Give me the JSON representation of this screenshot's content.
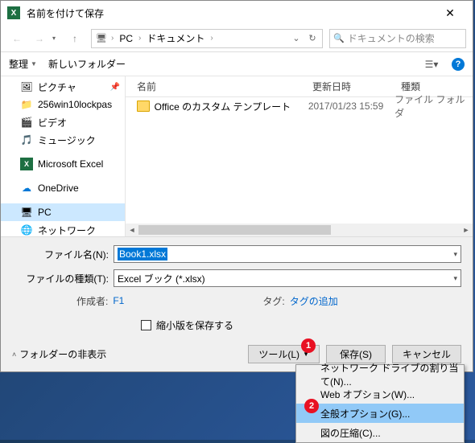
{
  "title": "名前を付けて保存",
  "nav": {
    "pc": "PC",
    "folder": "ドキュメント",
    "search_placeholder": "ドキュメントの検索",
    "refresh": "↻"
  },
  "toolbar": {
    "organize": "整理",
    "newfolder": "新しいフォルダー"
  },
  "sidebar": [
    {
      "icon": "🖼",
      "label": "ピクチャ",
      "pinned": true
    },
    {
      "icon": "📁",
      "label": "256win10lockpas"
    },
    {
      "icon": "🎬",
      "label": "ビデオ"
    },
    {
      "icon": "🎵",
      "label": "ミュージック"
    },
    {
      "icon": "X",
      "label": "Microsoft Excel",
      "excel": true
    },
    {
      "icon": "☁",
      "label": "OneDrive",
      "blue": true
    },
    {
      "icon": "🖥",
      "label": "PC",
      "selected": true
    },
    {
      "icon": "🌐",
      "label": "ネットワーク"
    }
  ],
  "filelist": {
    "headers": {
      "name": "名前",
      "date": "更新日時",
      "type": "種類"
    },
    "rows": [
      {
        "name": "Office のカスタム テンプレート",
        "date": "2017/01/23 15:59",
        "type": "ファイル フォルダ"
      }
    ]
  },
  "fields": {
    "filename_label": "ファイル名(N):",
    "filename_value": "Book1.xlsx",
    "filetype_label": "ファイルの種類(T):",
    "filetype_value": "Excel ブック (*.xlsx)",
    "author_label": "作成者:",
    "author_value": "F1",
    "tag_label": "タグ:",
    "tag_value": "タグの追加",
    "thumbnail_label": "縮小版を保存する"
  },
  "buttons": {
    "expand": "フォルダーの非表示",
    "tools": "ツール(L)",
    "save": "保存(S)",
    "cancel": "キャンセル"
  },
  "menu": [
    "ネットワーク ドライブの割り当て(N)...",
    "Web オプション(W)...",
    "全般オプション(G)...",
    "図の圧縮(C)..."
  ],
  "badges": {
    "b1": "1",
    "b2": "2"
  }
}
